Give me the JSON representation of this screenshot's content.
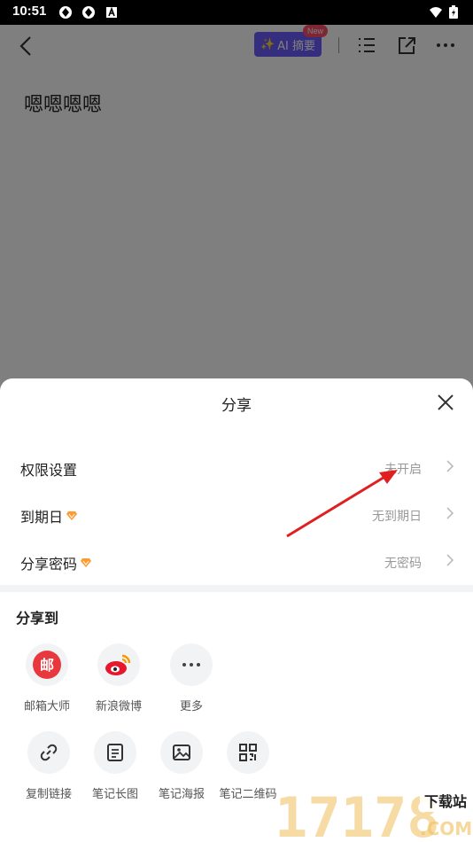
{
  "status_bar": {
    "time": "10:51"
  },
  "toolbar": {
    "ai_label": "AI 摘要",
    "ai_badge": "New"
  },
  "note": {
    "title": "嗯嗯嗯嗯"
  },
  "share_sheet": {
    "title": "分享",
    "settings": [
      {
        "label": "权限设置",
        "value": "未开启",
        "premium": false
      },
      {
        "label": "到期日",
        "value": "无到期日",
        "premium": true
      },
      {
        "label": "分享密码",
        "value": "无密码",
        "premium": true
      }
    ],
    "share_to_heading": "分享到",
    "targets_row1": [
      {
        "label": "邮箱大师",
        "icon": "mail-master-icon"
      },
      {
        "label": "新浪微博",
        "icon": "weibo-icon"
      },
      {
        "label": "更多",
        "icon": "more-icon"
      }
    ],
    "targets_row2": [
      {
        "label": "复制链接",
        "icon": "link-icon"
      },
      {
        "label": "笔记长图",
        "icon": "long-image-icon"
      },
      {
        "label": "笔记海报",
        "icon": "poster-icon"
      },
      {
        "label": "笔记二维码",
        "icon": "qrcode-icon"
      }
    ]
  },
  "watermark": {
    "digits": "17178",
    "tag": "下载站",
    "domain": ".COM"
  },
  "colors": {
    "ai_button": "#6b5cff",
    "badge": "#ff4d6a",
    "premium": "#ff9a2e",
    "mail_red": "#e8383d",
    "arrow": "#e02020"
  }
}
